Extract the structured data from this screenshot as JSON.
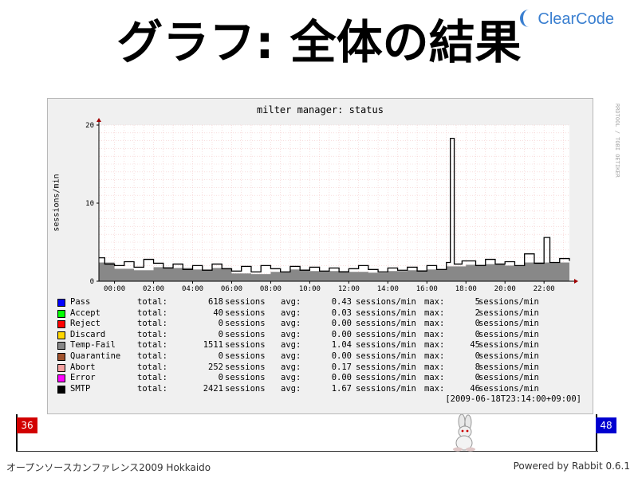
{
  "slide": {
    "title": "グラフ: 全体の結果",
    "logo_text": "ClearCode",
    "footer_left": "オープンソースカンファレンス2009 Hokkaido",
    "footer_right": "Powered by Rabbit 0.6.1",
    "page_current": "36",
    "page_total": "48"
  },
  "graph": {
    "title": "milter manager: status",
    "ylabel": "sessions/min",
    "side_credit": "RRDTOOL / TOBI OETIKER",
    "timestamp": "[2009-06-18T23:14:00+09:00]",
    "legend": [
      {
        "name": "Pass",
        "color": "#0000ff",
        "total": "618",
        "avg": "0.43",
        "max": "5"
      },
      {
        "name": "Accept",
        "color": "#00ff00",
        "total": "40",
        "avg": "0.03",
        "max": "2"
      },
      {
        "name": "Reject",
        "color": "#ff0000",
        "total": "0",
        "avg": "0.00",
        "max": "0"
      },
      {
        "name": "Discard",
        "color": "#ffd700",
        "total": "0",
        "avg": "0.00",
        "max": "0"
      },
      {
        "name": "Temp-Fail",
        "color": "#888888",
        "total": "1511",
        "avg": "1.04",
        "max": "45"
      },
      {
        "name": "Quarantine",
        "color": "#a0522d",
        "total": "0",
        "avg": "0.00",
        "max": "0"
      },
      {
        "name": "Abort",
        "color": "#f4a0a0",
        "total": "252",
        "avg": "0.17",
        "max": "8"
      },
      {
        "name": "Error",
        "color": "#ff00ff",
        "total": "0",
        "avg": "0.00",
        "max": "0"
      },
      {
        "name": "SMTP",
        "color": "#000000",
        "total": "2421",
        "avg": "1.67",
        "max": "46"
      }
    ],
    "labels": {
      "total": "total:",
      "sessions": "sessions",
      "avg": "avg:",
      "per_min": "sessions/min",
      "max": "max:"
    }
  },
  "chart_data": {
    "type": "area",
    "title": "milter manager: status",
    "ylabel": "sessions/min",
    "xlabel": "",
    "ylim": [
      0,
      20
    ],
    "yticks": [
      "0",
      "10",
      "20"
    ],
    "xticks": [
      "00:00",
      "02:00",
      "04:00",
      "06:00",
      "08:00",
      "10:00",
      "12:00",
      "14:00",
      "16:00",
      "18:00",
      "20:00",
      "22:00"
    ],
    "x_range_hours": [
      -0.8,
      23.3
    ],
    "grid": true,
    "legend_placement": "bottom",
    "series": [
      {
        "name": "SMTP",
        "color": "#000000",
        "style": "line",
        "points": [
          [
            -0.8,
            3.0
          ],
          [
            -0.5,
            2.2
          ],
          [
            0,
            2.0
          ],
          [
            0.5,
            2.5
          ],
          [
            1,
            1.8
          ],
          [
            1.5,
            2.8
          ],
          [
            2,
            2.3
          ],
          [
            2.5,
            1.7
          ],
          [
            3,
            2.2
          ],
          [
            3.5,
            1.5
          ],
          [
            4,
            2.0
          ],
          [
            4.5,
            1.4
          ],
          [
            5,
            2.2
          ],
          [
            5.5,
            1.6
          ],
          [
            6,
            1.3
          ],
          [
            6.5,
            1.9
          ],
          [
            7,
            1.2
          ],
          [
            7.5,
            2.0
          ],
          [
            8,
            1.6
          ],
          [
            8.5,
            1.2
          ],
          [
            9,
            1.9
          ],
          [
            9.5,
            1.4
          ],
          [
            10,
            1.8
          ],
          [
            10.5,
            1.3
          ],
          [
            11,
            1.7
          ],
          [
            11.5,
            1.2
          ],
          [
            12,
            1.6
          ],
          [
            12.5,
            2.0
          ],
          [
            13,
            1.5
          ],
          [
            13.5,
            1.2
          ],
          [
            14,
            1.7
          ],
          [
            14.5,
            1.4
          ],
          [
            15,
            1.8
          ],
          [
            15.5,
            1.3
          ],
          [
            16,
            2.0
          ],
          [
            16.5,
            1.5
          ],
          [
            17,
            2.4
          ],
          [
            17.2,
            18.3
          ],
          [
            17.4,
            2.2
          ],
          [
            17.8,
            2.6
          ],
          [
            18.5,
            2.0
          ],
          [
            19,
            2.8
          ],
          [
            19.5,
            2.2
          ],
          [
            20,
            2.5
          ],
          [
            20.5,
            2.0
          ],
          [
            21,
            3.5
          ],
          [
            21.5,
            2.3
          ],
          [
            22,
            5.6
          ],
          [
            22.3,
            2.4
          ],
          [
            22.8,
            2.9
          ],
          [
            23.3,
            2.6
          ]
        ]
      },
      {
        "name": "Temp-Fail",
        "color": "#888888",
        "style": "area",
        "points": [
          [
            -0.8,
            2.4
          ],
          [
            0,
            1.6
          ],
          [
            1,
            1.4
          ],
          [
            2,
            1.8
          ],
          [
            3,
            1.7
          ],
          [
            4,
            1.5
          ],
          [
            5,
            1.7
          ],
          [
            6,
            1.0
          ],
          [
            7,
            0.9
          ],
          [
            8,
            1.2
          ],
          [
            9,
            1.5
          ],
          [
            10,
            1.3
          ],
          [
            11,
            1.3
          ],
          [
            12,
            1.2
          ],
          [
            13,
            1.1
          ],
          [
            14,
            1.3
          ],
          [
            15,
            1.4
          ],
          [
            16,
            1.5
          ],
          [
            17,
            1.9
          ],
          [
            18,
            2.1
          ],
          [
            19,
            2.2
          ],
          [
            20,
            2.0
          ],
          [
            21,
            2.4
          ],
          [
            22,
            2.4
          ],
          [
            23.3,
            2.2
          ]
        ]
      },
      {
        "name": "Pass",
        "color": "#0000ff",
        "style": "area",
        "points": [
          [
            -0.8,
            0.6
          ],
          [
            0,
            0.3
          ],
          [
            1,
            0.5
          ],
          [
            2,
            0.6
          ],
          [
            3,
            0.4
          ],
          [
            4,
            0.4
          ],
          [
            5,
            0.4
          ],
          [
            6,
            0.3
          ],
          [
            7,
            0.3
          ],
          [
            8,
            0.4
          ],
          [
            9,
            0.5
          ],
          [
            10,
            0.3
          ],
          [
            11,
            0.2
          ],
          [
            12,
            0.3
          ],
          [
            13,
            0.2
          ],
          [
            14,
            0.4
          ],
          [
            15,
            0.5
          ],
          [
            16,
            0.3
          ],
          [
            17,
            0.5
          ],
          [
            18,
            0.4
          ],
          [
            19,
            0.4
          ],
          [
            20,
            0.5
          ],
          [
            21,
            0.5
          ],
          [
            22,
            0.7
          ],
          [
            23.3,
            0.6
          ]
        ]
      }
    ]
  }
}
